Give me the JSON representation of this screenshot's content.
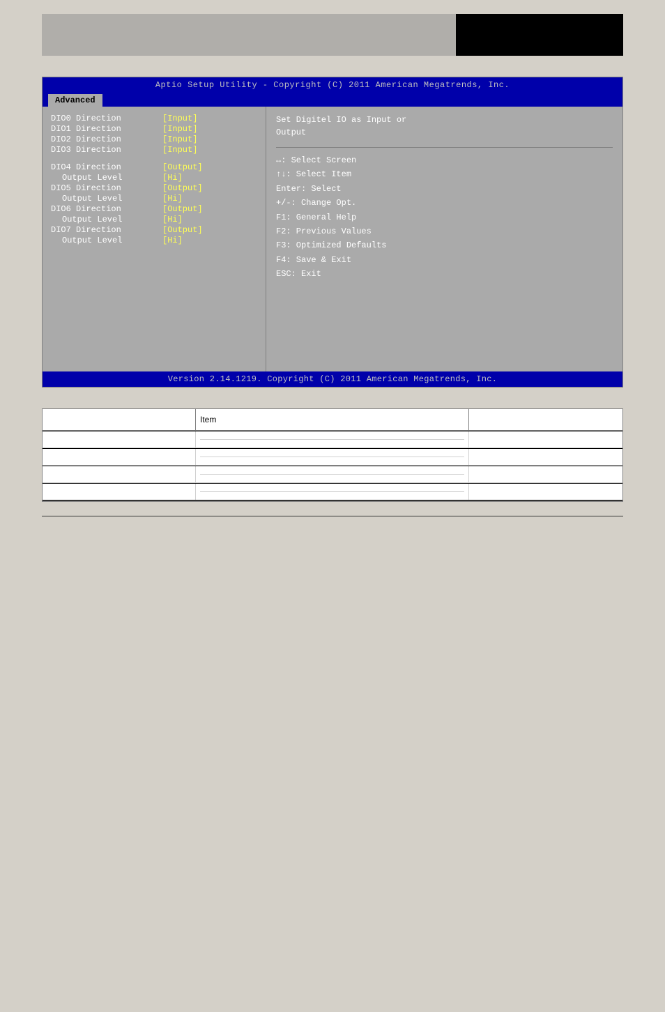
{
  "header": {
    "title_bar": "Aptio Setup Utility - Copyright (C) 2011 American Megatrends, Inc.",
    "tab": "Advanced",
    "footer": "Version 2.14.1219. Copyright (C) 2011 American Megatrends, Inc."
  },
  "bios": {
    "items": [
      {
        "name": "DIO0 Direction",
        "value": "[Input]",
        "indented": false
      },
      {
        "name": "DIO1 Direction",
        "value": "[Input]",
        "indented": false
      },
      {
        "name": "DIO2 Direction",
        "value": "[Input]",
        "indented": false
      },
      {
        "name": "DIO3 Direction",
        "value": "[Input]",
        "indented": false
      },
      {
        "spacer": true
      },
      {
        "name": "DIO4 Direction",
        "value": "[Output]",
        "indented": false
      },
      {
        "name": "Output Level",
        "value": "[Hi]",
        "indented": true
      },
      {
        "name": "DIO5 Direction",
        "value": "[Output]",
        "indented": false
      },
      {
        "name": "Output Level",
        "value": "[Hi]",
        "indented": true
      },
      {
        "name": "DIO6 Direction",
        "value": "[Output]",
        "indented": false
      },
      {
        "name": "Output Level",
        "value": "[Hi]",
        "indented": true
      },
      {
        "name": "DIO7 Direction",
        "value": "[Output]",
        "indented": false
      },
      {
        "name": "Output Level",
        "value": "[Hi]",
        "indented": true
      }
    ],
    "help_text_line1": "Set Digitel IO as Input or",
    "help_text_line2": "Output",
    "keys": [
      "↔: Select Screen",
      "↑↓: Select Item",
      "Enter: Select",
      "+/-: Change Opt.",
      "F1: General Help",
      "F2: Previous Values",
      "F3: Optimized Defaults",
      "F4: Save & Exit",
      "ESC: Exit"
    ]
  },
  "table": {
    "col1_header": "",
    "col2_header": "",
    "col3_header": "",
    "item_label": "Item",
    "groups": [
      {
        "header": "",
        "rows": [
          {
            "col1": "",
            "col2_lines": [
              "",
              ""
            ],
            "col3": ""
          }
        ]
      },
      {
        "header": "",
        "rows": [
          {
            "col1": "",
            "col2_lines": [
              "",
              ""
            ],
            "col3": ""
          }
        ]
      },
      {
        "header": "",
        "rows": [
          {
            "col1": "",
            "col2_lines": [
              "",
              ""
            ],
            "col3": ""
          }
        ]
      },
      {
        "header": "",
        "rows": [
          {
            "col1": "",
            "col2_lines": [
              "",
              ""
            ],
            "col3": ""
          }
        ]
      }
    ]
  }
}
